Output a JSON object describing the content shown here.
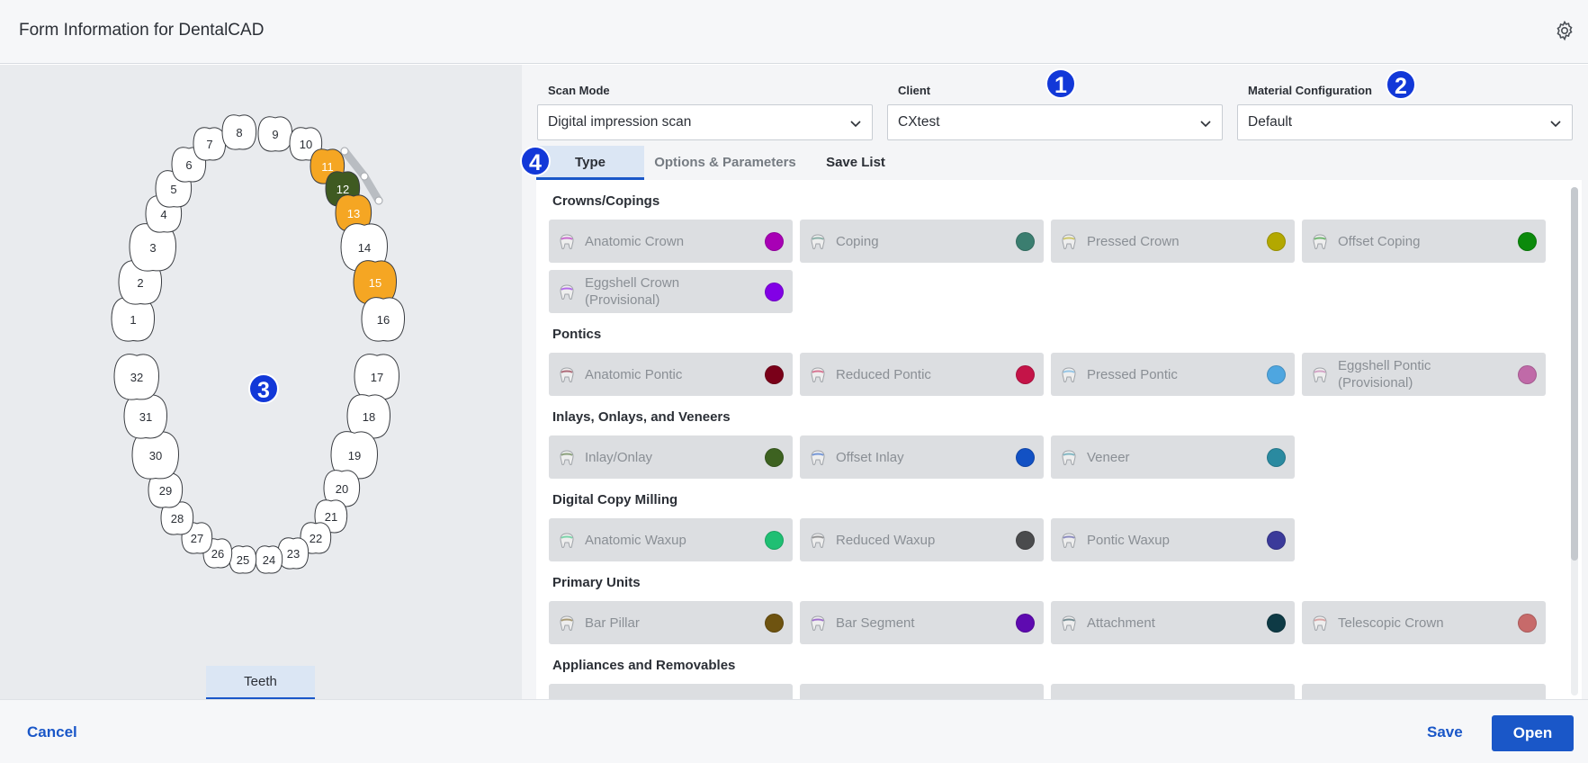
{
  "window": {
    "title": "Form Information for DentalCAD",
    "settings_icon": "gear-icon"
  },
  "fields": {
    "scan_mode": {
      "label": "Scan Mode",
      "value": "Digital impression scan"
    },
    "client": {
      "label": "Client",
      "value": "CXtest"
    },
    "material": {
      "label": "Material Configuration",
      "value": "Default"
    }
  },
  "badges": [
    "1",
    "2",
    "3",
    "4"
  ],
  "tabs": [
    {
      "label": "Type",
      "active": true
    },
    {
      "label": "Options & Parameters",
      "active": false
    },
    {
      "label": "Save List",
      "active": false
    }
  ],
  "left_tab": {
    "label": "Teeth"
  },
  "teeth": {
    "numbers": [
      "1",
      "2",
      "3",
      "4",
      "5",
      "6",
      "7",
      "8",
      "9",
      "10",
      "11",
      "12",
      "13",
      "14",
      "15",
      "16",
      "17",
      "18",
      "19",
      "20",
      "21",
      "22",
      "23",
      "24",
      "25",
      "26",
      "27",
      "28",
      "29",
      "30",
      "31",
      "32"
    ],
    "selected": {
      "11": "#f5a623",
      "12": "#3f5a21",
      "13": "#f5a623",
      "15": "#f5a623"
    }
  },
  "sections": [
    {
      "title": "Crowns/Copings",
      "items": [
        {
          "name": "Anatomic Crown",
          "color": "#a800b5"
        },
        {
          "name": "Coping",
          "color": "#3b7e70"
        },
        {
          "name": "Pressed Crown",
          "color": "#b3a800"
        },
        {
          "name": "Offset Coping",
          "color": "#0b8a0b"
        },
        {
          "name": "Eggshell Crown (Provisional)",
          "color": "#8200e6"
        }
      ]
    },
    {
      "title": "Pontics",
      "items": [
        {
          "name": "Anatomic Pontic",
          "color": "#7a0019"
        },
        {
          "name": "Reduced Pontic",
          "color": "#c41448"
        },
        {
          "name": "Pressed Pontic",
          "color": "#4ea6e0"
        },
        {
          "name": "Eggshell Pontic (Provisional)",
          "color": "#c06aa8"
        }
      ]
    },
    {
      "title": "Inlays, Onlays, and Veneers",
      "items": [
        {
          "name": "Inlay/Onlay",
          "color": "#3d6220"
        },
        {
          "name": "Offset Inlay",
          "color": "#1251c4"
        },
        {
          "name": "Veneer",
          "color": "#2a8aa0"
        }
      ]
    },
    {
      "title": "Digital Copy Milling",
      "items": [
        {
          "name": "Anatomic Waxup",
          "color": "#1fbf73"
        },
        {
          "name": "Reduced Waxup",
          "color": "#4a4b4d"
        },
        {
          "name": "Pontic Waxup",
          "color": "#3b3a9a"
        }
      ]
    },
    {
      "title": "Primary Units",
      "items": [
        {
          "name": "Bar Pillar",
          "color": "#6e5310"
        },
        {
          "name": "Bar Segment",
          "color": "#5e0ab0"
        },
        {
          "name": "Attachment",
          "color": "#0e3a45"
        },
        {
          "name": "Telescopic Crown",
          "color": "#c76a6a"
        }
      ]
    },
    {
      "title": "Appliances and Removables",
      "items": []
    }
  ],
  "footer": {
    "cancel": "Cancel",
    "save": "Save",
    "open": "Open"
  }
}
